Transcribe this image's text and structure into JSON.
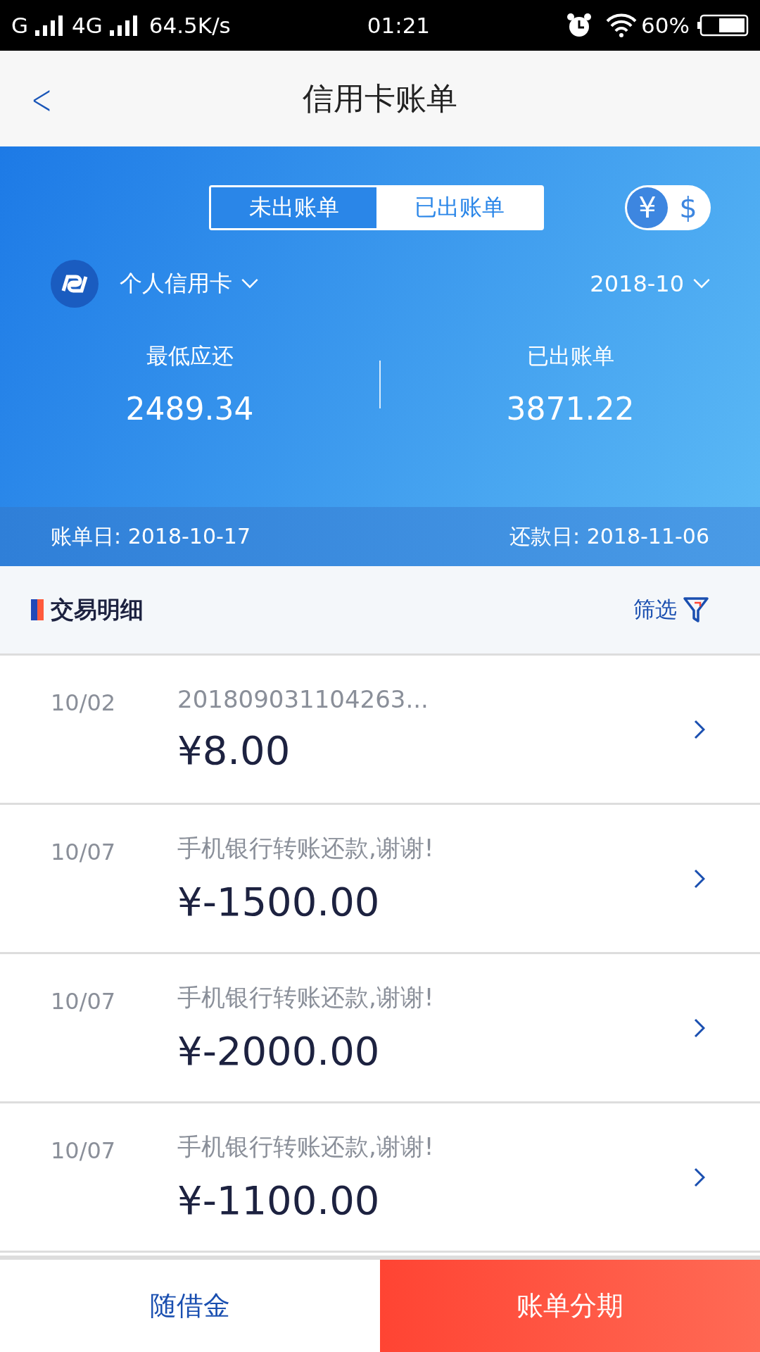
{
  "status_bar": {
    "carrier1": "G",
    "carrier2": "4G",
    "speed": "64.5K/s",
    "time": "01:21",
    "battery": "60%"
  },
  "nav": {
    "back": "<",
    "title": "信用卡账单"
  },
  "tabs": [
    {
      "label": "未出账单",
      "selected": true
    },
    {
      "label": "已出账单",
      "selected": false
    }
  ],
  "currency": [
    {
      "label": "¥",
      "selected": true
    },
    {
      "label": "$",
      "selected": false
    }
  ],
  "card": {
    "name": "个人信用卡",
    "month": "2018-10"
  },
  "summary": [
    {
      "label": "最低应还",
      "value": "2489.34"
    },
    {
      "label": "已出账单",
      "value": "3871.22"
    }
  ],
  "dates": {
    "bill_date": "账单日: 2018-10-17",
    "due_date": "还款日: 2018-11-06"
  },
  "section": {
    "title": "交易明细",
    "filter": "筛选"
  },
  "transactions": [
    {
      "date": "10/02",
      "desc": "201809031104263...",
      "amount": "¥8.00"
    },
    {
      "date": "10/07",
      "desc": "手机银行转账还款,谢谢!",
      "amount": "¥-1500.00"
    },
    {
      "date": "10/07",
      "desc": "手机银行转账还款,谢谢!",
      "amount": "¥-2000.00"
    },
    {
      "date": "10/07",
      "desc": "手机银行转账还款,谢谢!",
      "amount": "¥-1100.00"
    }
  ],
  "bottom": {
    "left": "随借金",
    "right": "账单分期"
  }
}
